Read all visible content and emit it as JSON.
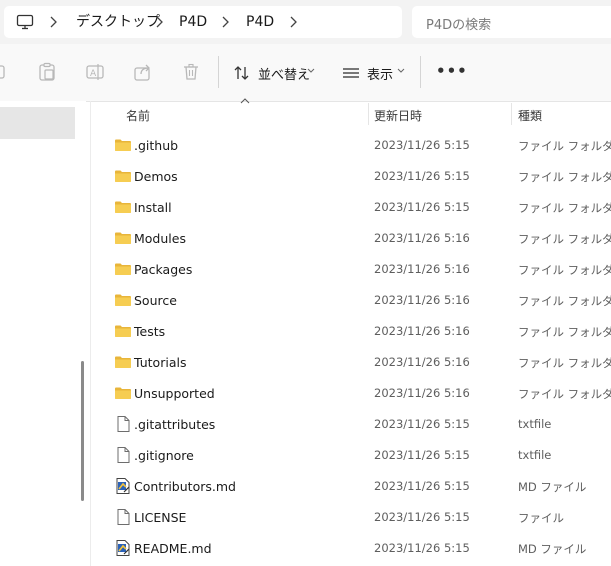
{
  "breadcrumb": [
    "デスクトップ",
    "P4D",
    "P4D"
  ],
  "search": {
    "placeholder": "P4Dの検索"
  },
  "toolbar": {
    "sort_label": "並べ替え",
    "view_label": "表示",
    "more_label": "•••"
  },
  "columns": {
    "name": "名前",
    "modified": "更新日時",
    "type": "種類"
  },
  "files": [
    {
      "name": ".github",
      "modified": "2023/11/26 5:15",
      "type": "ファイル フォルダー",
      "icon": "folder-icon"
    },
    {
      "name": "Demos",
      "modified": "2023/11/26 5:15",
      "type": "ファイル フォルダー",
      "icon": "folder-icon"
    },
    {
      "name": "Install",
      "modified": "2023/11/26 5:15",
      "type": "ファイル フォルダー",
      "icon": "folder-icon"
    },
    {
      "name": "Modules",
      "modified": "2023/11/26 5:16",
      "type": "ファイル フォルダー",
      "icon": "folder-icon"
    },
    {
      "name": "Packages",
      "modified": "2023/11/26 5:16",
      "type": "ファイル フォルダー",
      "icon": "folder-icon"
    },
    {
      "name": "Source",
      "modified": "2023/11/26 5:16",
      "type": "ファイル フォルダー",
      "icon": "folder-icon"
    },
    {
      "name": "Tests",
      "modified": "2023/11/26 5:16",
      "type": "ファイル フォルダー",
      "icon": "folder-icon"
    },
    {
      "name": "Tutorials",
      "modified": "2023/11/26 5:16",
      "type": "ファイル フォルダー",
      "icon": "folder-icon"
    },
    {
      "name": "Unsupported",
      "modified": "2023/11/26 5:16",
      "type": "ファイル フォルダー",
      "icon": "folder-icon"
    },
    {
      "name": ".gitattributes",
      "modified": "2023/11/26 5:15",
      "type": "txtfile",
      "icon": "file-icon"
    },
    {
      "name": ".gitignore",
      "modified": "2023/11/26 5:15",
      "type": "txtfile",
      "icon": "file-icon"
    },
    {
      "name": "Contributors.md",
      "modified": "2023/11/26 5:15",
      "type": "MD ファイル",
      "icon": "markdown-file-icon"
    },
    {
      "name": "LICENSE",
      "modified": "2023/11/26 5:15",
      "type": "ファイル",
      "icon": "file-icon"
    },
    {
      "name": "README.md",
      "modified": "2023/11/26 5:15",
      "type": "MD ファイル",
      "icon": "markdown-file-icon"
    }
  ],
  "colors": {
    "folder": "#f4c542",
    "selection": "#e6e6e6",
    "accent": "#0067c0"
  }
}
